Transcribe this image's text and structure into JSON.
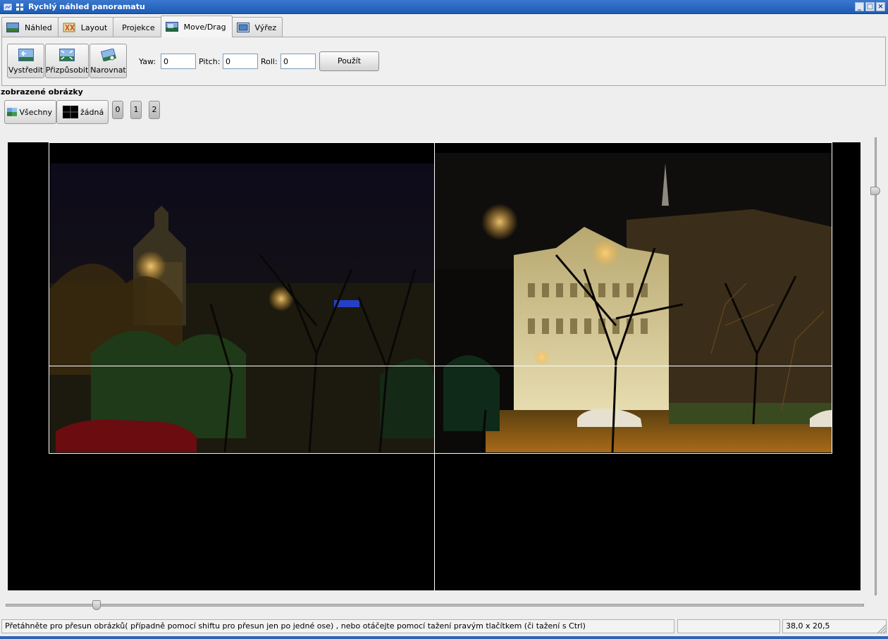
{
  "window": {
    "title": "Rychlý náhled panoramatu",
    "controls": [
      "_",
      "□",
      "×"
    ]
  },
  "tabs": [
    {
      "label": "Náhled",
      "icon": "preview-icon"
    },
    {
      "label": "Layout",
      "icon": "layout-icon"
    },
    {
      "label": "Projekce",
      "icon": ""
    },
    {
      "label": "Move/Drag",
      "icon": "move-drag-icon",
      "active": true
    },
    {
      "label": "Výřez",
      "icon": "crop-icon"
    }
  ],
  "toolbar": {
    "center_label": "Vystředit",
    "fit_label": "Přizpůsobit",
    "straighten_label": "Narovnat",
    "yaw_label": "Yaw:",
    "yaw_value": "0",
    "pitch_label": "Pitch:",
    "pitch_value": "0",
    "roll_label": "Roll:",
    "roll_value": "0",
    "apply_label": "Použít"
  },
  "images_section": {
    "title": "zobrazené obrázky",
    "all_label": "Všechny",
    "none_label": "žádná",
    "image_buttons": [
      "0",
      "1",
      "2"
    ]
  },
  "zoom": {
    "vertical_slider_fraction": 0.12,
    "horizontal_slider_fraction": 0.11
  },
  "status": {
    "message": "Přetáhněte pro přesun obrázků( případně pomocí shiftu pro přesun jen po jedné ose) , nebo otáčejte pomocí tažení pravým tlačítkem (či tažení s Ctrl)",
    "middle": "",
    "fov": "38,0 x 20,5"
  },
  "colors": {
    "titlebar": "#2a6cc6",
    "canvas": "#000000",
    "grid": "#ffffff"
  }
}
